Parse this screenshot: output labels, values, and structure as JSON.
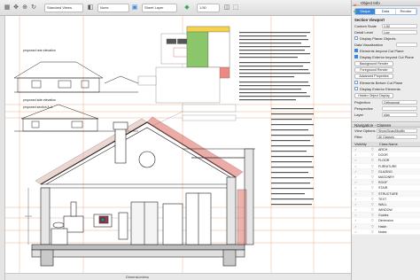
{
  "toolbar": {
    "search_field": "Standard Views",
    "class_field": "None",
    "layer_field": "Sheet Layer",
    "scale_field": "1:50"
  },
  "rail": {},
  "canvas": {
    "sheet_title_left": "proposed rear elevation",
    "sheet_title_left2": "proposed side elevation",
    "section_title": "proposed section A-A",
    "zoom_label": "Dimensionless"
  },
  "colors": {
    "accent": "#3d86d8",
    "roof_tile_red": "#b74242",
    "guide_orange": "#e8955a",
    "brick_hatch": "#d8695e"
  },
  "panel": {
    "title": "Object Info",
    "tabs": [
      "Shape",
      "Data",
      "Render"
    ],
    "active_tab": "Shape",
    "section_head": "Section Viewport",
    "rows": [
      {
        "label": "Custom Scale",
        "value": "1:50"
      },
      {
        "label": "Detail Level",
        "value": "Low"
      },
      {
        "label": "Display Planar Objects",
        "value": ""
      },
      {
        "label": "Data Visualization",
        "value": ""
      }
    ],
    "checks": [
      {
        "label": "Display Planar Objects",
        "on": false
      },
      {
        "label": "Elements beyond Cut Plane",
        "on": true
      },
      {
        "label": "Display Exterior beyond Cut Plane",
        "on": true
      },
      {
        "label": "Elements Before Cut Plane",
        "on": false
      },
      {
        "label": "Display Exterior Elements",
        "on": false
      }
    ],
    "buttons": [
      "Background Render",
      "Foreground Render",
      "Advanced Properties",
      "Hidden Object Display"
    ],
    "projection": {
      "label": "Projection",
      "value": "Orthogonal"
    },
    "perspective": {
      "label": "Perspective",
      "value": ""
    },
    "layer_label": {
      "label": "Layer",
      "value": "plan"
    },
    "navigation_title": "Navigation - Classes",
    "view_options_label": "View Options",
    "view_options_value": "Show/Snap/Modify",
    "filter_label": "Filter",
    "filter_value": "All Classes",
    "columns": [
      "Visibility",
      "Class Name"
    ],
    "classes": [
      "ARCH",
      "DOOR",
      "FLOOR",
      "FURNITURE",
      "GLAZING",
      "MASONRY",
      "ROOF",
      "STAIR",
      "STRUCTURE",
      "TEXT",
      "WALL",
      "WINDOW",
      "Guides",
      "Dimension",
      "Hatch",
      "Notes",
      "Site"
    ]
  }
}
